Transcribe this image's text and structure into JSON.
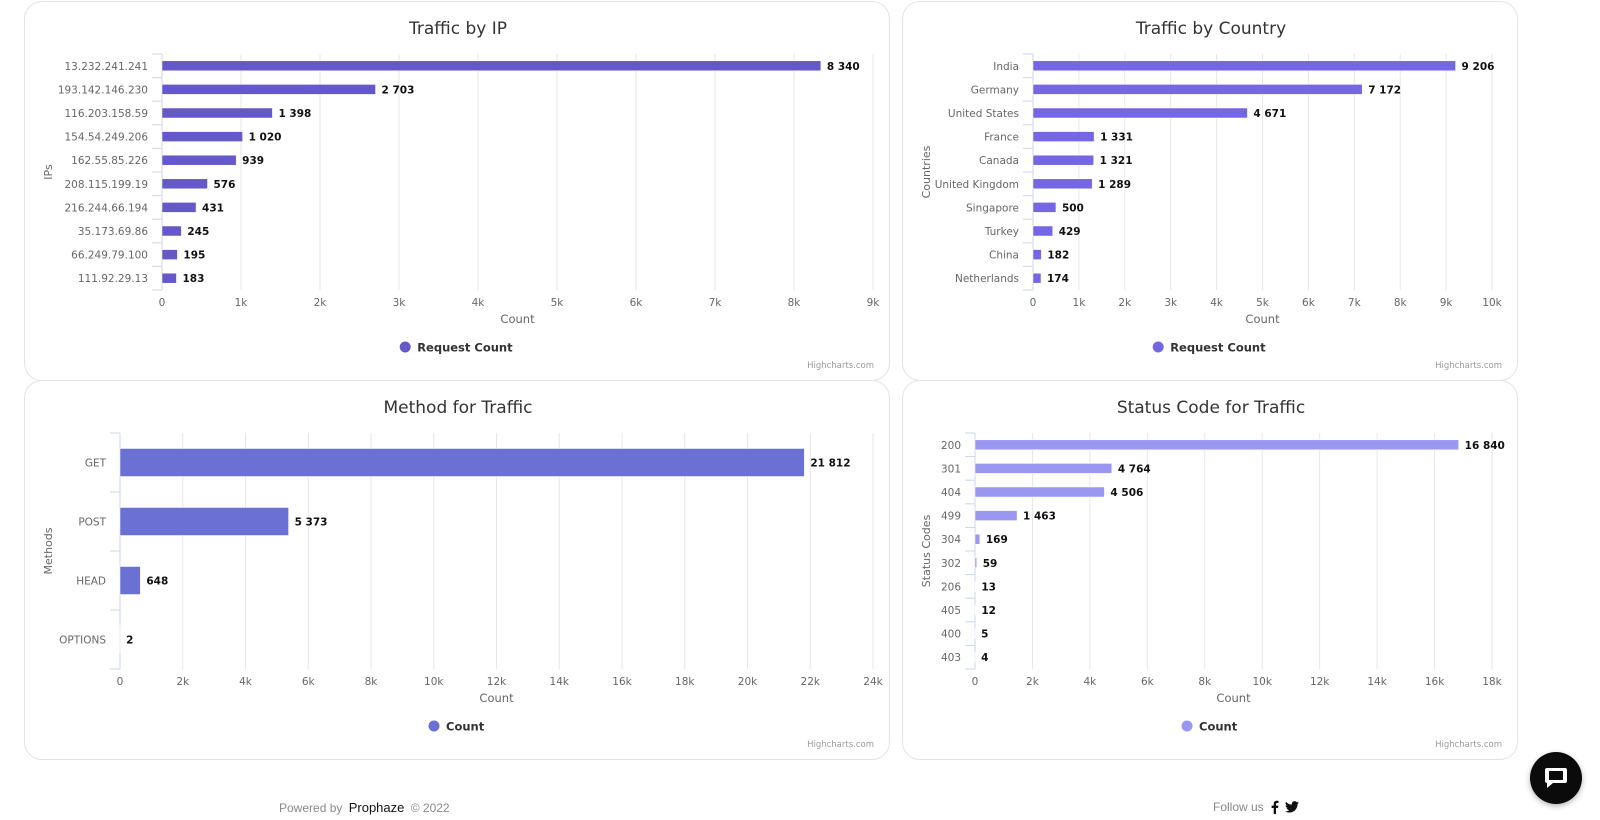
{
  "chart_data": [
    {
      "id": "traffic-by-ip",
      "type": "bar",
      "orientation": "horizontal",
      "title": "Traffic by IP",
      "xlabel": "Count",
      "ylabel": "IPs",
      "categories": [
        "13.232.241.241",
        "193.142.146.230",
        "116.203.158.59",
        "154.54.249.206",
        "162.55.85.226",
        "208.115.199.19",
        "216.244.66.194",
        "35.173.69.86",
        "66.249.79.100",
        "111.92.29.13"
      ],
      "values": [
        8340,
        2703,
        1398,
        1020,
        939,
        576,
        431,
        245,
        195,
        183
      ],
      "data_labels": [
        "8 340",
        "2 703",
        "1 398",
        "1 020",
        "939",
        "576",
        "431",
        "245",
        "195",
        "183"
      ],
      "xlim": [
        0,
        9000
      ],
      "ticks": [
        0,
        1000,
        2000,
        3000,
        4000,
        5000,
        6000,
        7000,
        8000,
        9000
      ],
      "tick_labels": [
        "0",
        "1k",
        "2k",
        "3k",
        "4k",
        "5k",
        "6k",
        "7k",
        "8k",
        "9k"
      ],
      "legend": "Request Count",
      "legend_position": "bottom-center",
      "color": "#6559c9",
      "grid": true,
      "credits": "Highcharts.com"
    },
    {
      "id": "traffic-by-country",
      "type": "bar",
      "orientation": "horizontal",
      "title": "Traffic by Country",
      "xlabel": "Count",
      "ylabel": "Countries",
      "categories": [
        "India",
        "Germany",
        "United States",
        "France",
        "Canada",
        "United Kingdom",
        "Singapore",
        "Turkey",
        "China",
        "Netherlands"
      ],
      "values": [
        9206,
        7172,
        4671,
        1331,
        1321,
        1289,
        500,
        429,
        182,
        174
      ],
      "data_labels": [
        "9 206",
        "7 172",
        "4 671",
        "1 331",
        "1 321",
        "1 289",
        "500",
        "429",
        "182",
        "174"
      ],
      "xlim": [
        0,
        10000
      ],
      "ticks": [
        0,
        1000,
        2000,
        3000,
        4000,
        5000,
        6000,
        7000,
        8000,
        9000,
        10000
      ],
      "tick_labels": [
        "0",
        "1k",
        "2k",
        "3k",
        "4k",
        "5k",
        "6k",
        "7k",
        "8k",
        "9k",
        "10k"
      ],
      "legend": "Request Count",
      "legend_position": "bottom-center",
      "color": "#7566e4",
      "grid": true,
      "credits": "Highcharts.com"
    },
    {
      "id": "method-for-traffic",
      "type": "bar",
      "orientation": "horizontal",
      "title": "Method for Traffic",
      "xlabel": "Count",
      "ylabel": "Methods",
      "categories": [
        "GET",
        "POST",
        "HEAD",
        "OPTIONS"
      ],
      "values": [
        21812,
        5373,
        648,
        2
      ],
      "data_labels": [
        "21 812",
        "5 373",
        "648",
        "2"
      ],
      "xlim": [
        0,
        24000
      ],
      "ticks": [
        0,
        2000,
        4000,
        6000,
        8000,
        10000,
        12000,
        14000,
        16000,
        18000,
        20000,
        22000,
        24000
      ],
      "tick_labels": [
        "0",
        "2k",
        "4k",
        "6k",
        "8k",
        "10k",
        "12k",
        "14k",
        "16k",
        "18k",
        "20k",
        "22k",
        "24k"
      ],
      "legend": "Count",
      "legend_position": "bottom-center",
      "color": "#6b70d4",
      "grid": true,
      "credits": "Highcharts.com"
    },
    {
      "id": "status-code-for-traffic",
      "type": "bar",
      "orientation": "horizontal",
      "title": "Status Code for Traffic",
      "xlabel": "Count",
      "ylabel": "Status Codes",
      "categories": [
        "200",
        "301",
        "404",
        "499",
        "304",
        "302",
        "206",
        "405",
        "400",
        "403"
      ],
      "values": [
        16840,
        4764,
        4506,
        1463,
        169,
        59,
        13,
        12,
        5,
        4
      ],
      "data_labels": [
        "16 840",
        "4 764",
        "4 506",
        "1 463",
        "169",
        "59",
        "13",
        "12",
        "5",
        "4"
      ],
      "xlim": [
        0,
        18000
      ],
      "ticks": [
        0,
        2000,
        4000,
        6000,
        8000,
        10000,
        12000,
        14000,
        16000,
        18000
      ],
      "tick_labels": [
        "0",
        "2k",
        "4k",
        "6k",
        "8k",
        "10k",
        "12k",
        "14k",
        "16k",
        "18k"
      ],
      "legend": "Count",
      "legend_position": "bottom-center",
      "color": "#9a97f0",
      "grid": true,
      "credits": "Highcharts.com"
    }
  ],
  "footer": {
    "powered_by": "Powered by",
    "brand": "Prophaze",
    "copyright": "© 2022",
    "follow_us": "Follow us",
    "social_icons": [
      "facebook-icon",
      "twitter-icon"
    ]
  },
  "chat": {
    "icon": "chat-bubble-icon"
  }
}
